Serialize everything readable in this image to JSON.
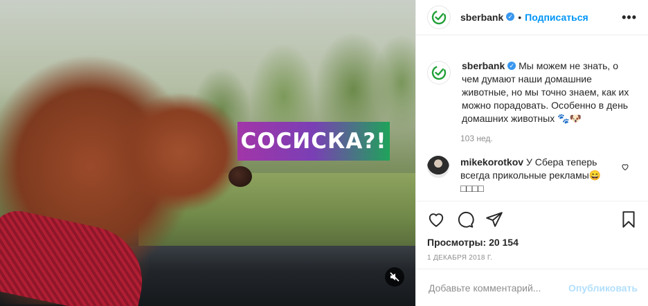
{
  "media": {
    "overlay_text": "СОСИСКА?!"
  },
  "header": {
    "username": "sberbank",
    "separator": "•",
    "follow_label": "Подписаться",
    "more_label": "•••"
  },
  "caption": {
    "username": "sberbank",
    "text": "Мы можем не знать, о чем думают наши домашние животные, но мы точно знаем, как их можно порадовать. Особенно в день домашних животных 🐾🐶",
    "timestamp": "103 нед."
  },
  "comments": [
    {
      "username": "mikekorotkov",
      "text": "У Сбера теперь всегда прикольные рекламы😄 □□□□"
    }
  ],
  "actions": {
    "views_label": "Просмотры:",
    "views_count": "20 154",
    "date": "1 ДЕКАБРЯ 2018 Г."
  },
  "add_comment": {
    "placeholder": "Добавьте комментарий...",
    "publish_label": "Опубликовать"
  },
  "colors": {
    "link": "#0095f6",
    "verified": "#3897f0",
    "publish_disabled": "#b2dffc",
    "sber_green": "#21a038"
  }
}
